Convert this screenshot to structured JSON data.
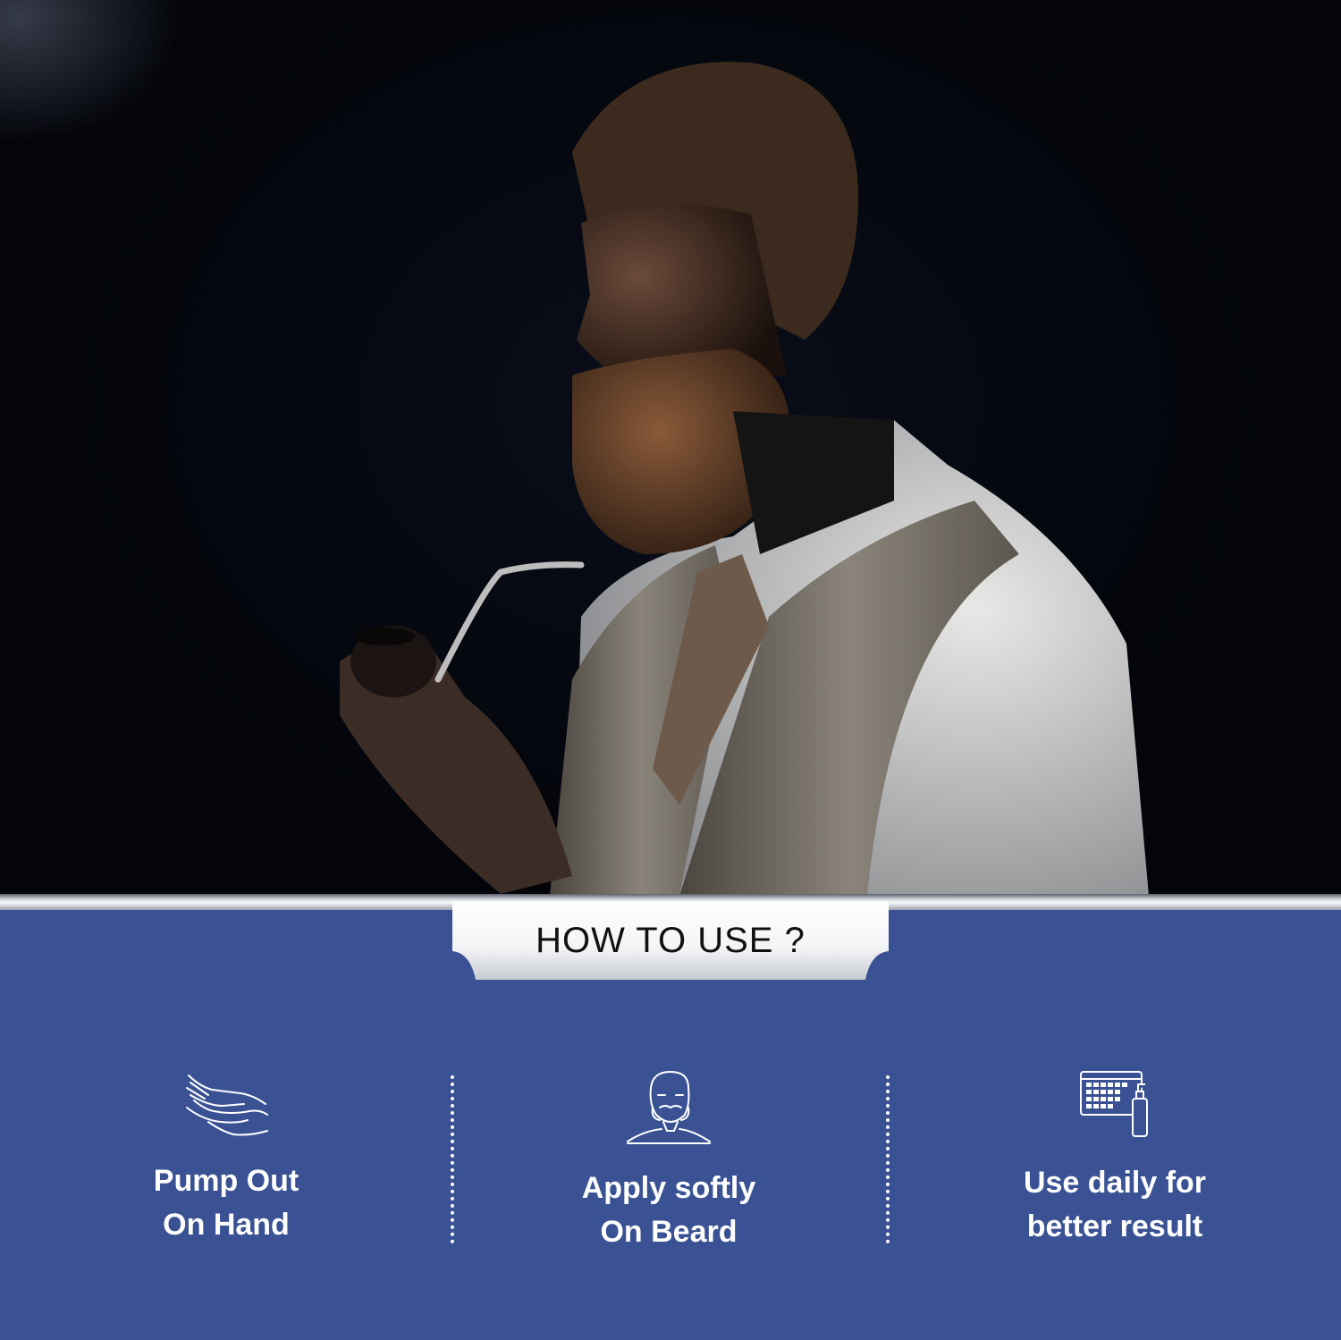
{
  "section_title": "HOW TO USE ?",
  "steps": [
    {
      "icon": "hand-pump-icon",
      "line1": "Pump Out",
      "line2": "On Hand"
    },
    {
      "icon": "bearded-man-icon",
      "line1": "Apply softly",
      "line2": "On Beard"
    },
    {
      "icon": "calendar-bottle-icon",
      "line1": "Use daily for",
      "line2": "better result"
    }
  ],
  "colors": {
    "panel_blue": "#3a5293",
    "photo_background": "#05070d",
    "text_dark": "#111111",
    "text_light": "#ffffff"
  }
}
